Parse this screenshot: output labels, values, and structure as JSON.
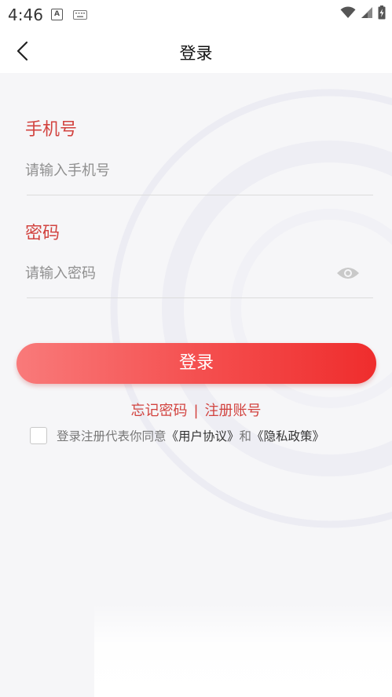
{
  "status_bar": {
    "time": "4:46",
    "notif_icon_letter": "A",
    "icons": [
      "a-notification-icon",
      "keyboard-icon",
      "wifi-icon",
      "cellular-signal-icon",
      "battery-charging-icon"
    ]
  },
  "nav": {
    "title": "登录",
    "back_icon": "back-arrow-icon"
  },
  "form": {
    "phone_label": "手机号",
    "phone_placeholder": "请输入手机号",
    "phone_value": "",
    "password_label": "密码",
    "password_placeholder": "请输入密码",
    "password_value": ""
  },
  "login_button": "登录",
  "links": {
    "forgot_password": "忘记密码",
    "separator": "|",
    "register": "注册账号"
  },
  "agreement": {
    "checked": false,
    "prefix": "登录注册代表你同意",
    "user_agreement": "《用户协议》",
    "conjunction": "和",
    "privacy_policy": "《隐私政策》"
  },
  "colors": {
    "accent": "#d2433f",
    "button_gradient_start": "#f97a7a",
    "button_gradient_end": "#ef2d2d",
    "background": "#f6f6f8"
  }
}
